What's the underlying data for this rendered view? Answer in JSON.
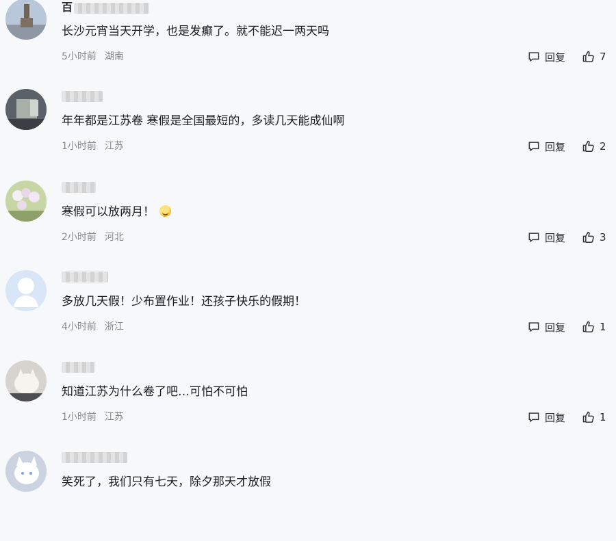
{
  "comments": [
    {
      "username": "百",
      "text": "长沙元宵当天开学，也是发癫了。就不能迟一两天吗",
      "time": "5小时前",
      "region": "湖南",
      "reply_label": "回复",
      "likes": "7",
      "has_emoji": false,
      "avatar_icon": "tower-photo-avatar-icon"
    },
    {
      "username": "",
      "text": "年年都是江苏卷 寒假是全国最短的，多读几天能成仙啊",
      "time": "1小时前",
      "region": "江苏",
      "reply_label": "回复",
      "likes": "2",
      "has_emoji": false,
      "avatar_icon": "room-photo-avatar-icon"
    },
    {
      "username": "",
      "text": "寒假可以放两月！",
      "time": "2小时前",
      "region": "河北",
      "reply_label": "回复",
      "likes": "3",
      "has_emoji": true,
      "avatar_icon": "flower-photo-avatar-icon"
    },
    {
      "username": "",
      "text": "多放几天假！少布置作业！还孩子快乐的假期！",
      "time": "4小时前",
      "region": "浙江",
      "reply_label": "回复",
      "likes": "1",
      "has_emoji": false,
      "avatar_icon": "default-user-avatar-icon"
    },
    {
      "username": "",
      "text": "知道江苏为什么卷了吧…可怕不可怕",
      "time": "1小时前",
      "region": "江苏",
      "reply_label": "回复",
      "likes": "1",
      "has_emoji": false,
      "avatar_icon": "cat-photo-avatar-icon"
    },
    {
      "username": "",
      "text": "笑死了，我们只有七天，除夕那天才放假",
      "time": "",
      "region": "",
      "reply_label": "",
      "likes": "",
      "has_emoji": false,
      "avatar_icon": "white-cat-avatar-icon"
    }
  ],
  "icons": {
    "reply": "comment-bubble-icon",
    "like": "thumbs-up-icon",
    "laugh_emoji": "laughing-face-emoji-icon"
  },
  "colors": {
    "background": "#f7f8fa",
    "meta_text": "#8a8a8a",
    "body_text": "#1d1d1d"
  }
}
